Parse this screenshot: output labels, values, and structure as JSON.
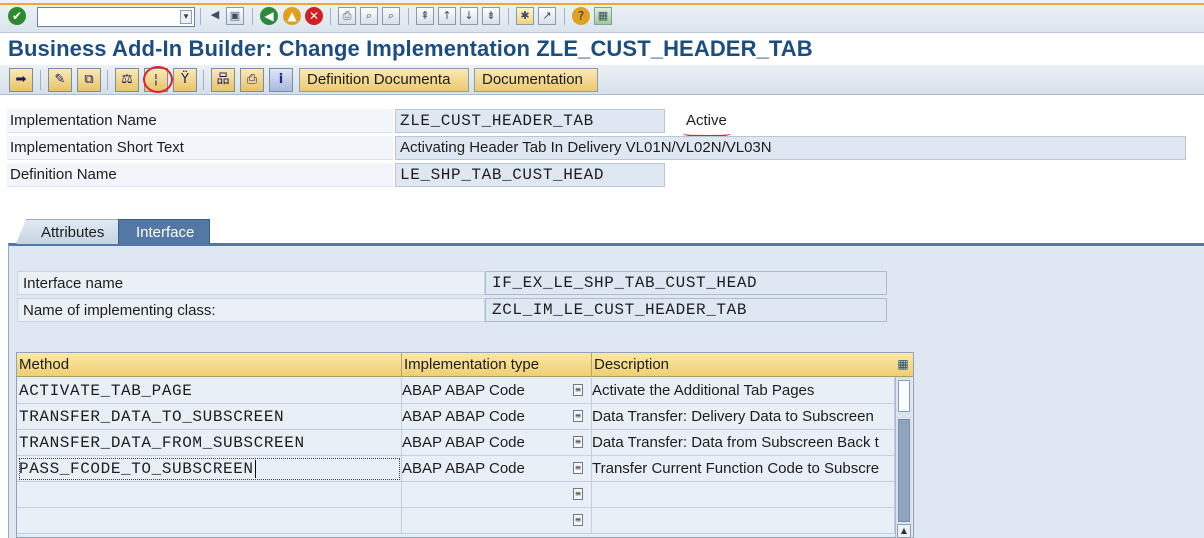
{
  "systoolbar": {
    "command_field_value": "",
    "icons": [
      "enter-icon",
      "back-icon",
      "exit-icon",
      "cancel-icon",
      "save-icon",
      "print-icon",
      "find-icon",
      "find-next-icon",
      "first-page-icon",
      "prev-page-icon",
      "next-page-icon",
      "last-page-icon",
      "new-session-icon",
      "shortcut-icon",
      "help-icon",
      "customize-layout-icon"
    ]
  },
  "header": {
    "title": "Business Add-In Builder: Change Implementation ZLE_CUST_HEADER_TAB"
  },
  "apptoolbar": {
    "definition_docs_label": "Definition Documenta",
    "documentation_label": "Documentation"
  },
  "fields": {
    "impl_name_label": "Implementation Name",
    "impl_name_value": "ZLE_CUST_HEADER_TAB",
    "status": "Active",
    "short_text_label": "Implementation Short Text",
    "short_text_value": "Activating Header Tab In Delivery VL01N/VL02N/VL03N",
    "def_name_label": "Definition Name",
    "def_name_value": "LE_SHP_TAB_CUST_HEAD"
  },
  "tabs": [
    {
      "label": "Attributes",
      "active": false
    },
    {
      "label": "Interface",
      "active": true
    }
  ],
  "interface": {
    "name_label": "Interface name",
    "name_value": "IF_EX_LE_SHP_TAB_CUST_HEAD",
    "class_label": "Name of implementing class:",
    "class_value": "ZCL_IM_LE_CUST_HEADER_TAB"
  },
  "grid": {
    "columns": [
      "Method",
      "Implementation type",
      "Description"
    ],
    "rows": [
      {
        "method": "ACTIVATE_TAB_PAGE",
        "type": "ABAP ABAP Code",
        "desc": "Activate the Additional Tab Pages"
      },
      {
        "method": "TRANSFER_DATA_TO_SUBSCREEN",
        "type": "ABAP ABAP Code",
        "desc": "Data Transfer: Delivery Data to Subscreen"
      },
      {
        "method": "TRANSFER_DATA_FROM_SUBSCREEN",
        "type": "ABAP ABAP Code",
        "desc": "Data Transfer: Data from Subscreen Back t"
      },
      {
        "method": "PASS_FCODE_TO_SUBSCREEN",
        "type": "ABAP ABAP Code",
        "desc": "Transfer Current Function Code to Subscre"
      },
      {
        "method": "",
        "type": "",
        "desc": ""
      },
      {
        "method": "",
        "type": "",
        "desc": ""
      }
    ]
  },
  "annotation_color": "#e0202a",
  "accent": "#1b4d80",
  "tab_active_color": "#5478a6"
}
